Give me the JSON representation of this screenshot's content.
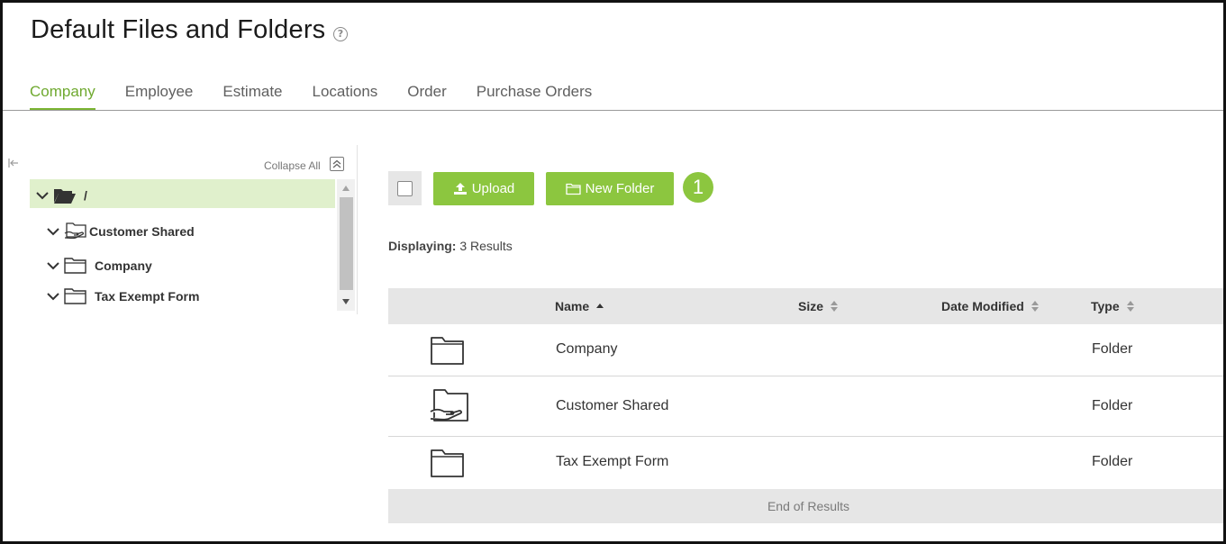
{
  "page": {
    "title": "Default Files and Folders",
    "help_icon": "question-circle-icon"
  },
  "tabs": [
    {
      "label": "Company",
      "active": true
    },
    {
      "label": "Employee",
      "active": false
    },
    {
      "label": "Estimate",
      "active": false
    },
    {
      "label": "Locations",
      "active": false
    },
    {
      "label": "Order",
      "active": false
    },
    {
      "label": "Purchase Orders",
      "active": false
    }
  ],
  "tree": {
    "collapse_all_label": "Collapse All",
    "root_label": "/",
    "items": [
      {
        "label": "Customer Shared",
        "icon": "shared-folder-icon"
      },
      {
        "label": "Company",
        "icon": "folder-icon"
      },
      {
        "label": "Tax Exempt Form",
        "icon": "folder-icon"
      }
    ]
  },
  "toolbar": {
    "upload_label": "Upload",
    "new_folder_label": "New Folder",
    "step_badge": "1"
  },
  "results": {
    "displaying_label": "Displaying:",
    "count_text": "3 Results"
  },
  "table": {
    "columns": {
      "name": "Name",
      "size": "Size",
      "date_modified": "Date Modified",
      "type": "Type"
    },
    "sort": {
      "column": "Name",
      "direction": "ascending"
    },
    "rows": [
      {
        "name": "Company",
        "size": "",
        "date_modified": "",
        "type": "Folder",
        "icon": "folder-icon"
      },
      {
        "name": "Customer Shared",
        "size": "",
        "date_modified": "",
        "type": "Folder",
        "icon": "shared-folder-icon"
      },
      {
        "name": "Tax Exempt Form",
        "size": "",
        "date_modified": "",
        "type": "Folder",
        "icon": "folder-icon"
      }
    ],
    "footer": "End of Results"
  },
  "colors": {
    "accent": "#8cc63f",
    "active_tab": "#6fa92f",
    "selected_row": "#e0f0cc",
    "header_bg": "#e6e6e6"
  }
}
